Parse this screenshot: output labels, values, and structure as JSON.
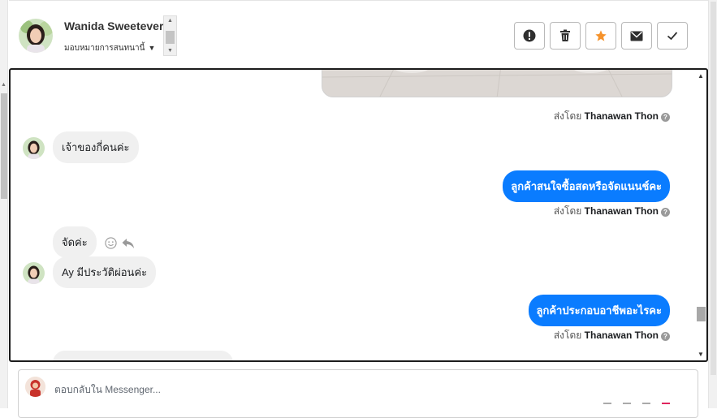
{
  "header": {
    "contact_name": "Wanida Sweetever",
    "assign_label": "มอบหมายการสนทนานี้",
    "actions": [
      {
        "name": "report-icon",
        "label": "report"
      },
      {
        "name": "trash-icon",
        "label": "delete"
      },
      {
        "name": "star-icon",
        "label": "star"
      },
      {
        "name": "mail-icon",
        "label": "mark unread"
      },
      {
        "name": "check-icon",
        "label": "done"
      }
    ]
  },
  "messages": {
    "m1_sender_prefix": "ส่งโดย",
    "m1_sender": "Thanawan Thon",
    "m2_text": "เจ้าของกี่คนค่ะ",
    "m3_text": "ลูกค้าสนใจซื้อสดหรือจัดแนนช์คะ",
    "m3_sender_prefix": "ส่งโดย",
    "m3_sender": "Thanawan Thon",
    "m4_text": "จัดค่ะ",
    "m5_text": "Ay มีประวัติผ่อนค่ะ",
    "m6_text": "ลูกค้าประกอบอาชีพอะไรคะ",
    "m6_sender_prefix": "ส่งโดย",
    "m6_sender": "Thanawan Thon"
  },
  "reply": {
    "placeholder": "ตอบกลับใน Messenger..."
  },
  "colors": {
    "outgoing": "#0a7cff",
    "incoming": "#f0f0f0",
    "star": "#f5922b"
  }
}
